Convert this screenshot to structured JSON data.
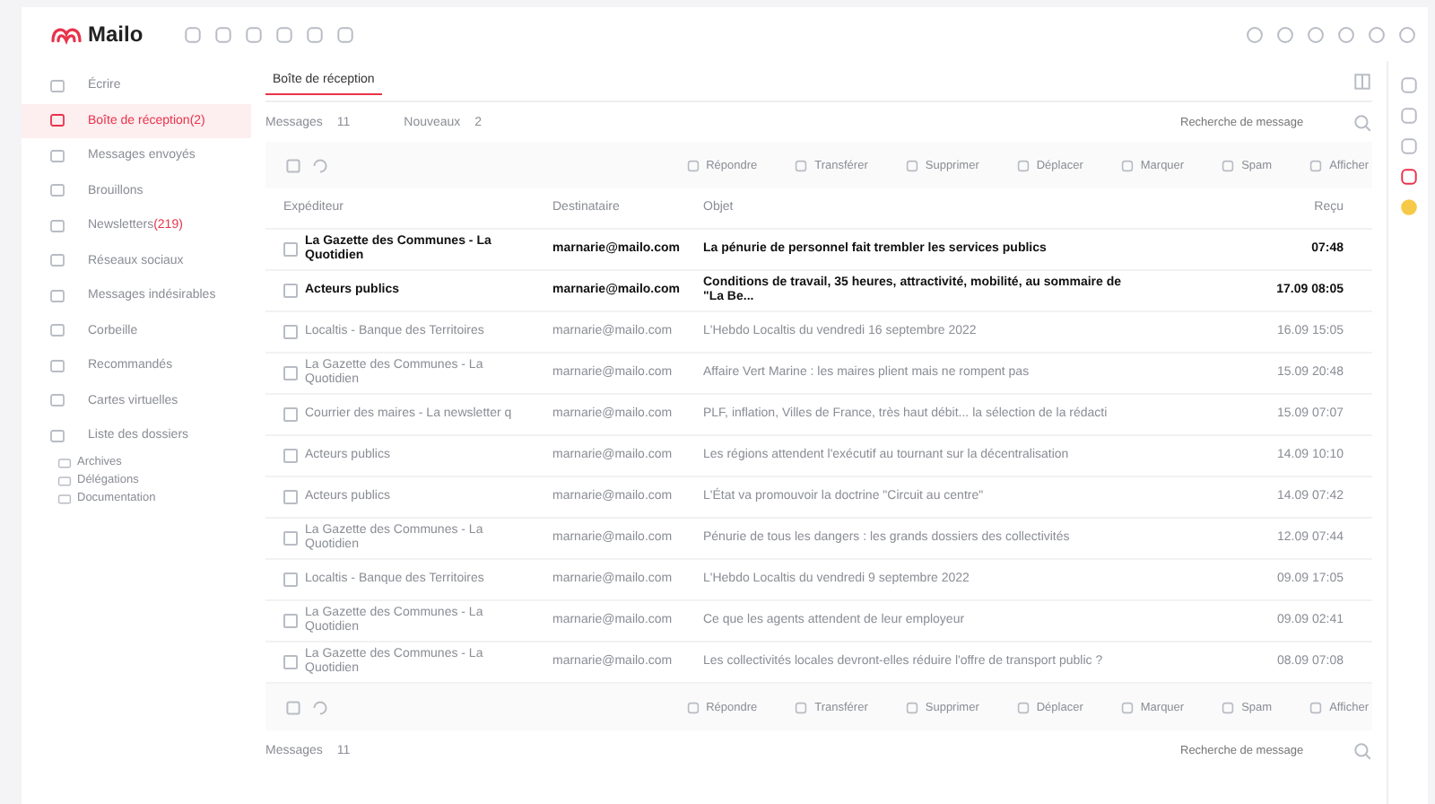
{
  "app": {
    "logo_text": "Mailo"
  },
  "sidebar": {
    "items": [
      {
        "label": "Écrire",
        "selected": false
      },
      {
        "label": "Boîte de réception",
        "count": "(2)",
        "selected": true
      },
      {
        "label": "Messages envoyés",
        "selected": false
      },
      {
        "label": "Brouillons",
        "selected": false
      },
      {
        "label": "Newsletters",
        "count": "(219)",
        "selected": false
      },
      {
        "label": "Réseaux sociaux",
        "selected": false
      },
      {
        "label": "Messages indésirables",
        "selected": false
      },
      {
        "label": "Corbeille",
        "selected": false
      },
      {
        "label": "Recommandés",
        "selected": false
      },
      {
        "label": "Cartes virtuelles",
        "selected": false
      },
      {
        "label": "Liste des dossiers",
        "selected": false,
        "children": [
          {
            "label": "Archives"
          },
          {
            "label": "Délégations"
          },
          {
            "label": "Documentation"
          }
        ]
      }
    ]
  },
  "tabs": [
    {
      "label": "Boîte de réception",
      "selected": true
    }
  ],
  "filters": [
    {
      "label": "Messages",
      "value": "11"
    },
    {
      "label": "Nouveaux",
      "value": "2"
    }
  ],
  "search": {
    "placeholder": "Recherche de message"
  },
  "toolbar": [
    "Répondre",
    "Transférer",
    "Supprimer",
    "Déplacer",
    "Marquer",
    "Spam",
    "Afficher"
  ],
  "bottom_toolbar": [
    "Répondre",
    "Transférer",
    "Supprimer",
    "Déplacer",
    "Marquer",
    "Spam",
    "Afficher"
  ],
  "table": {
    "columns": [
      "Expéditeur",
      "Destinataire",
      "Objet",
      "Reçu"
    ],
    "rows": [
      {
        "sender": "La Gazette des Communes - La Quotidien",
        "to": "marnarie@mailo.com",
        "subject": "La pénurie de personnel fait trembler les services publics",
        "received": "07:48",
        "unread": true,
        "checked": false
      },
      {
        "sender": "Acteurs publics",
        "to": "marnarie@mailo.com",
        "subject": "Conditions de travail, 35 heures, attractivité, mobilité, au sommaire de \"La Be...",
        "received": "17.09 08:05",
        "unread": true,
        "checked": false
      },
      {
        "sender": "Localtis - Banque des Territoires",
        "to": "marnarie@mailo.com",
        "subject": "L'Hebdo Localtis du vendredi 16 septembre 2022",
        "received": "16.09 15:05",
        "unread": false,
        "checked": false
      },
      {
        "sender": "La Gazette des Communes - La Quotidien",
        "to": "marnarie@mailo.com",
        "subject": "Affaire Vert Marine : les maires plient mais ne rompent pas",
        "received": "15.09 20:48",
        "unread": false,
        "checked": false
      },
      {
        "sender": "Courrier des maires - La newsletter q",
        "to": "marnarie@mailo.com",
        "subject": "PLF, inflation, Villes de France, très haut débit... la sélection de la rédacti",
        "received": "15.09 07:07",
        "unread": false,
        "checked": false
      },
      {
        "sender": "Acteurs publics",
        "to": "marnarie@mailo.com",
        "subject": "Les régions attendent l'exécutif au tournant sur la décentralisation",
        "received": "14.09 10:10",
        "unread": false,
        "checked": false
      },
      {
        "sender": "Acteurs publics",
        "to": "marnarie@mailo.com",
        "subject": "L'État va promouvoir la doctrine \"Circuit au centre\"",
        "received": "14.09 07:42",
        "unread": false,
        "checked": false
      },
      {
        "sender": "La Gazette des Communes - La Quotidien",
        "to": "marnarie@mailo.com",
        "subject": "Pénurie de tous les dangers : les grands dossiers des collectivités",
        "received": "12.09 07:44",
        "unread": false,
        "checked": false
      },
      {
        "sender": "Localtis - Banque des Territoires",
        "to": "marnarie@mailo.com",
        "subject": "L'Hebdo Localtis du vendredi 9 septembre 2022",
        "received": "09.09 17:05",
        "unread": false,
        "checked": false
      },
      {
        "sender": "La Gazette des Communes - La Quotidien",
        "to": "marnarie@mailo.com",
        "subject": "Ce que les agents attendent de leur employeur",
        "received": "09.09 02:41",
        "unread": false,
        "checked": false
      },
      {
        "sender": "La Gazette des Communes - La Quotidien",
        "to": "marnarie@mailo.com",
        "subject": "Les collectivités locales devront-elles réduire l'offre de transport public ?",
        "received": "08.09 07:08",
        "unread": false,
        "checked": false
      }
    ]
  },
  "footer": {
    "filter": {
      "label": "Messages",
      "value": "11"
    },
    "search": {
      "placeholder": "Recherche de message"
    }
  }
}
